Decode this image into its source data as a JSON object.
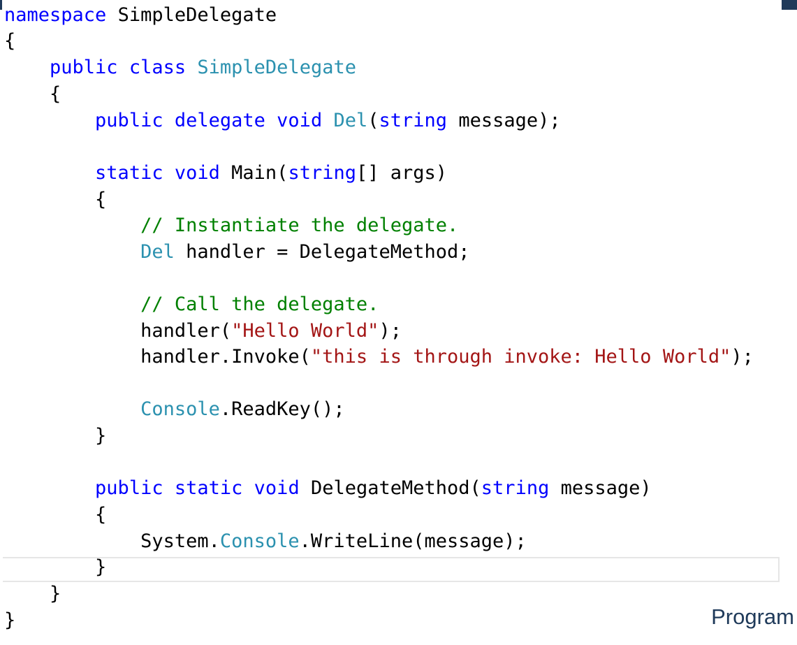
{
  "editor": {
    "lines": [
      [
        {
          "t": "namespace",
          "c": "kw"
        },
        {
          "t": " SimpleDelegate",
          "c": "plain"
        }
      ],
      [
        {
          "t": "{",
          "c": "plain"
        }
      ],
      [
        {
          "t": "    ",
          "c": "plain"
        },
        {
          "t": "public",
          "c": "kw"
        },
        {
          "t": " ",
          "c": "plain"
        },
        {
          "t": "class",
          "c": "kw"
        },
        {
          "t": " ",
          "c": "plain"
        },
        {
          "t": "SimpleDelegate",
          "c": "type"
        }
      ],
      [
        {
          "t": "    {",
          "c": "plain"
        }
      ],
      [
        {
          "t": "        ",
          "c": "plain"
        },
        {
          "t": "public",
          "c": "kw"
        },
        {
          "t": " ",
          "c": "plain"
        },
        {
          "t": "delegate",
          "c": "kw"
        },
        {
          "t": " ",
          "c": "plain"
        },
        {
          "t": "void",
          "c": "kw"
        },
        {
          "t": " ",
          "c": "plain"
        },
        {
          "t": "Del",
          "c": "type"
        },
        {
          "t": "(",
          "c": "plain"
        },
        {
          "t": "string",
          "c": "kw"
        },
        {
          "t": " message);",
          "c": "plain"
        }
      ],
      [
        {
          "t": "",
          "c": "plain"
        }
      ],
      [
        {
          "t": "        ",
          "c": "plain"
        },
        {
          "t": "static",
          "c": "kw"
        },
        {
          "t": " ",
          "c": "plain"
        },
        {
          "t": "void",
          "c": "kw"
        },
        {
          "t": " Main(",
          "c": "plain"
        },
        {
          "t": "string",
          "c": "kw"
        },
        {
          "t": "[] args)",
          "c": "plain"
        }
      ],
      [
        {
          "t": "        {",
          "c": "plain"
        }
      ],
      [
        {
          "t": "            ",
          "c": "plain"
        },
        {
          "t": "// Instantiate the delegate.",
          "c": "comment"
        }
      ],
      [
        {
          "t": "            ",
          "c": "plain"
        },
        {
          "t": "Del",
          "c": "type"
        },
        {
          "t": " handler = DelegateMethod;",
          "c": "plain"
        }
      ],
      [
        {
          "t": "",
          "c": "plain"
        }
      ],
      [
        {
          "t": "            ",
          "c": "plain"
        },
        {
          "t": "// Call the delegate.",
          "c": "comment"
        }
      ],
      [
        {
          "t": "            handler(",
          "c": "plain"
        },
        {
          "t": "\"Hello World\"",
          "c": "string"
        },
        {
          "t": ");",
          "c": "plain"
        }
      ],
      [
        {
          "t": "            handler.Invoke(",
          "c": "plain"
        },
        {
          "t": "\"this is through invoke: Hello World\"",
          "c": "string"
        },
        {
          "t": ");",
          "c": "plain"
        }
      ],
      [
        {
          "t": "",
          "c": "plain"
        }
      ],
      [
        {
          "t": "            ",
          "c": "plain"
        },
        {
          "t": "Console",
          "c": "type"
        },
        {
          "t": ".ReadKey();",
          "c": "plain"
        }
      ],
      [
        {
          "t": "        }",
          "c": "plain"
        }
      ],
      [
        {
          "t": "",
          "c": "plain"
        }
      ],
      [
        {
          "t": "        ",
          "c": "plain"
        },
        {
          "t": "public",
          "c": "kw"
        },
        {
          "t": " ",
          "c": "plain"
        },
        {
          "t": "static",
          "c": "kw"
        },
        {
          "t": " ",
          "c": "plain"
        },
        {
          "t": "void",
          "c": "kw"
        },
        {
          "t": " DelegateMethod(",
          "c": "plain"
        },
        {
          "t": "string",
          "c": "kw"
        },
        {
          "t": " message)",
          "c": "plain"
        }
      ],
      [
        {
          "t": "        {",
          "c": "plain"
        }
      ],
      [
        {
          "t": "            System.",
          "c": "plain"
        },
        {
          "t": "Console",
          "c": "type"
        },
        {
          "t": ".WriteLine(message);",
          "c": "plain"
        }
      ],
      [
        {
          "t": "        }",
          "c": "plain"
        }
      ],
      [
        {
          "t": "    }",
          "c": "plain"
        }
      ],
      [
        {
          "t": "}",
          "c": "plain"
        }
      ]
    ],
    "syntax_colors": {
      "keyword": "#0000ff",
      "type": "#2b91af",
      "comment": "#008000",
      "string": "#a31515",
      "plain": "#000000"
    }
  },
  "footer": {
    "label": "Program"
  }
}
